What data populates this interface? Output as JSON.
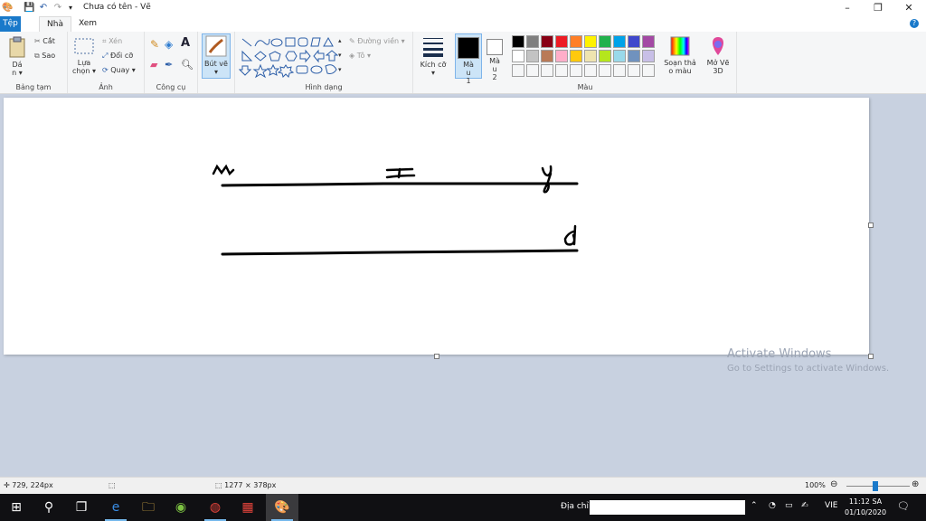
{
  "titlebar": {
    "title": "Chưa có tên - Vẽ",
    "minimize": "–",
    "maximize": "❐",
    "close": "✕"
  },
  "tabs": [
    {
      "label": "Tệp"
    },
    {
      "label": "Nhà"
    },
    {
      "label": "Xem"
    }
  ],
  "help": "?",
  "ribbon": {
    "clipboard": {
      "label": "Bảng tạm",
      "paste": "Dá n ▾",
      "cut": "Cắt",
      "copy": "Sao"
    },
    "image": {
      "label": "Ảnh",
      "select": "Lựa chọn ▾",
      "crop": "Xén",
      "resize": "Đổi cỡ",
      "rotate": "Quay ▾"
    },
    "tools": {
      "label": "Công cụ"
    },
    "brushes": {
      "label": "Bút vẽ ▾"
    },
    "shapes": {
      "label": "Hình dạng",
      "outline": "Đường viền ▾",
      "fill": "Tô ▾"
    },
    "size": {
      "label": "Kích cỡ ▾"
    },
    "color1": {
      "label": "Mà u 1",
      "color": "#000000"
    },
    "color2": {
      "label": "Mà u 2",
      "color": "#ffffff"
    },
    "colors": {
      "label": "Màu",
      "palette": [
        "#000000",
        "#7f7f7f",
        "#880015",
        "#ed1c24",
        "#ff7f27",
        "#fff200",
        "#22b14c",
        "#00a2e8",
        "#3f48cc",
        "#a349a4",
        "#ffffff",
        "#c3c3c3",
        "#b97a57",
        "#ffaec9",
        "#ffc90e",
        "#efe4b0",
        "#b5e61d",
        "#99d9ea",
        "#7092be",
        "#c8bfe7"
      ]
    },
    "edit_colors": {
      "label": "Soạn thả o màu"
    },
    "paint3d": {
      "label": "Mở Vẽ 3D"
    }
  },
  "drawing": {
    "letters": [
      "M",
      "x",
      "y",
      "d"
    ]
  },
  "statusbar": {
    "cursor": "729, 224px",
    "size": "1277 × 378px",
    "zoom": "100%"
  },
  "watermark": {
    "line1": "Activate Windows",
    "line2": "Go to Settings to activate Windows."
  },
  "taskbar": {
    "address_label": "Địa chỉ",
    "lang": "VIE",
    "time": "11:12 SA",
    "date": "01/10/2020"
  }
}
